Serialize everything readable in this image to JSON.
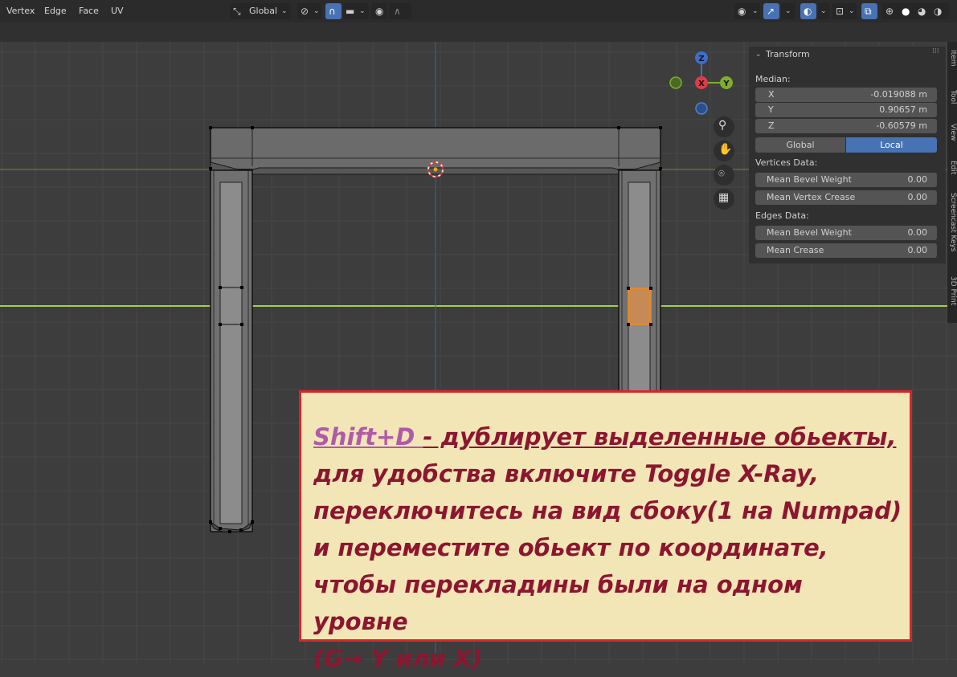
{
  "header": {
    "menu": [
      "Vertex",
      "Edge",
      "Face",
      "UV"
    ],
    "transform_orientation": "Global"
  },
  "side_tabs": [
    "Item",
    "Tool",
    "View",
    "Edit",
    "Screencast Keys",
    "3D Print"
  ],
  "npanel": {
    "title": "Transform",
    "median_label": "Median:",
    "x_label": "X",
    "x_value": "-0.019088 m",
    "y_label": "Y",
    "y_value": "0.90657 m",
    "z_label": "Z",
    "z_value": "-0.60579 m",
    "global_label": "Global",
    "local_label": "Local",
    "vertices_heading": "Vertices Data:",
    "v_bevel_label": "Mean Bevel Weight",
    "v_bevel_value": "0.00",
    "v_crease_label": "Mean Vertex Crease",
    "v_crease_value": "0.00",
    "edges_heading": "Edges Data:",
    "e_bevel_label": "Mean Bevel Weight",
    "e_bevel_value": "0.00",
    "e_crease_label": "Mean Crease",
    "e_crease_value": "0.00"
  },
  "gizmo": {
    "x": "X",
    "y": "Y",
    "z": "Z"
  },
  "callout": {
    "shortcut": "Shift+D ",
    "line1_rest": "- дублирует выделенные обьекты,",
    "line2": " для удобства включите Toggle X-Ray,",
    "line3": "переключитесь на вид сбоку(1 на Numpad)",
    "line4": "и переместите обьект по координате,",
    "line5": "чтобы перекладины были на одном уровне",
    "line6": "(G→ Y или X)"
  },
  "colors": {
    "accent": "#4772b3",
    "selection": "#f08a24",
    "callout_border": "#d6262a",
    "callout_text": "#8c1630",
    "shortcut": "#b05aa8"
  }
}
